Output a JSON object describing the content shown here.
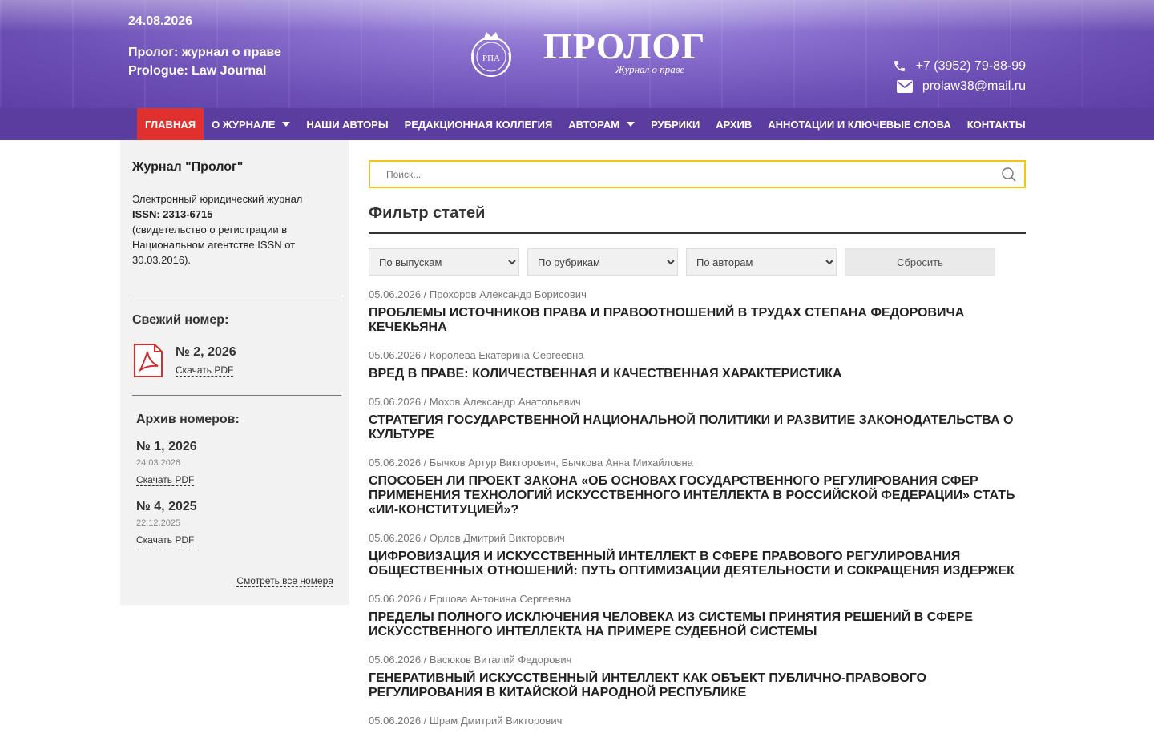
{
  "header": {
    "date": "24.08.2026",
    "title_ru": "Пролог: журнал о праве",
    "title_en": "Prologue: Law Journal",
    "logo_word": "ПРОЛОГ",
    "logo_sub": "Журнал о праве",
    "seal_text": "РПА",
    "phone": "+7 (3952) 79-88-99",
    "email": "prolaw38@mail.ru"
  },
  "nav": {
    "items": [
      {
        "label": "Главная",
        "active": true,
        "caret": false
      },
      {
        "label": "О журнале",
        "active": false,
        "caret": true
      },
      {
        "label": "Наши авторы",
        "active": false,
        "caret": false
      },
      {
        "label": "Редакционная коллегия",
        "active": false,
        "caret": false
      },
      {
        "label": "Авторам",
        "active": false,
        "caret": true
      },
      {
        "label": "Рубрики",
        "active": false,
        "caret": false
      },
      {
        "label": "Архив",
        "active": false,
        "caret": false
      },
      {
        "label": "Аннотации и ключевые слова",
        "active": false,
        "caret": false
      },
      {
        "label": "Контакты",
        "active": false,
        "caret": false
      }
    ]
  },
  "sidebar": {
    "title": "Журнал \"Пролог\"",
    "desc": "Электронный юридический журнал",
    "issn": "ISSN: 2313-6715",
    "reg": "(свидетельство о регистрации в Национальном агентстве ISSN от 30.03.2016).",
    "fresh_title": "Свежий номер:",
    "fresh_issue": "№ 2, 2026",
    "download": "Скачать PDF",
    "archive_title": "Архив номеров:",
    "archive": [
      {
        "num": "№ 1, 2026",
        "date": "24.03.2026",
        "link": "Скачать PDF"
      },
      {
        "num": "№ 4, 2025",
        "date": "22.12.2025",
        "link": "Скачать PDF"
      }
    ],
    "all_issues": "Смотреть все номера"
  },
  "main": {
    "search_placeholder": "Поиск...",
    "filter_title": "Фильтр статей",
    "filters": {
      "issues": "По выпускам",
      "rubrics": "По рубрикам",
      "authors": "По авторам",
      "reset": "Сбросить"
    },
    "articles": [
      {
        "meta": "05.06.2026 / Прохоров Александр Борисович",
        "title": "Проблемы источников права и правоотношений в трудах Степана Федоровича Кечекьяна"
      },
      {
        "meta": "05.06.2026 / Королева Екатерина Сергеевна",
        "title": "Вред в праве: количественная и качественная характеристика"
      },
      {
        "meta": "05.06.2026 / Мохов Александр Анатольевич",
        "title": "Стратегия государственной национальной политики и развитие законодательства о культуре"
      },
      {
        "meta": "05.06.2026 / Бычков Артур Викторович, Бычкова Анна Михайловна",
        "title": "Способен ли проект закона «Об основах государственного регулирования сфер применения технологий искусственного интеллекта в Российской Федерации» стать «ИИ-конституцией»?"
      },
      {
        "meta": "05.06.2026 / Орлов Дмитрий Викторович",
        "title": "Цифровизация и искусственный интеллект в сфере правового регулирования общественных отношений: путь оптимизации деятельности и сокращения издержек"
      },
      {
        "meta": "05.06.2026 / Ершова Антонина Сергеевна",
        "title": "Пределы полного исключения человека из системы принятия решений в сфере искусственного интеллекта на примере судебной системы"
      },
      {
        "meta": "05.06.2026 / Васюков Виталий Федорович",
        "title": "Генеративный искусственный интеллект как объект публично-правового регулирования в Китайской Народной Республике"
      },
      {
        "meta": "05.06.2026 / Шрам Дмитрий Викторович",
        "title": ""
      }
    ]
  }
}
